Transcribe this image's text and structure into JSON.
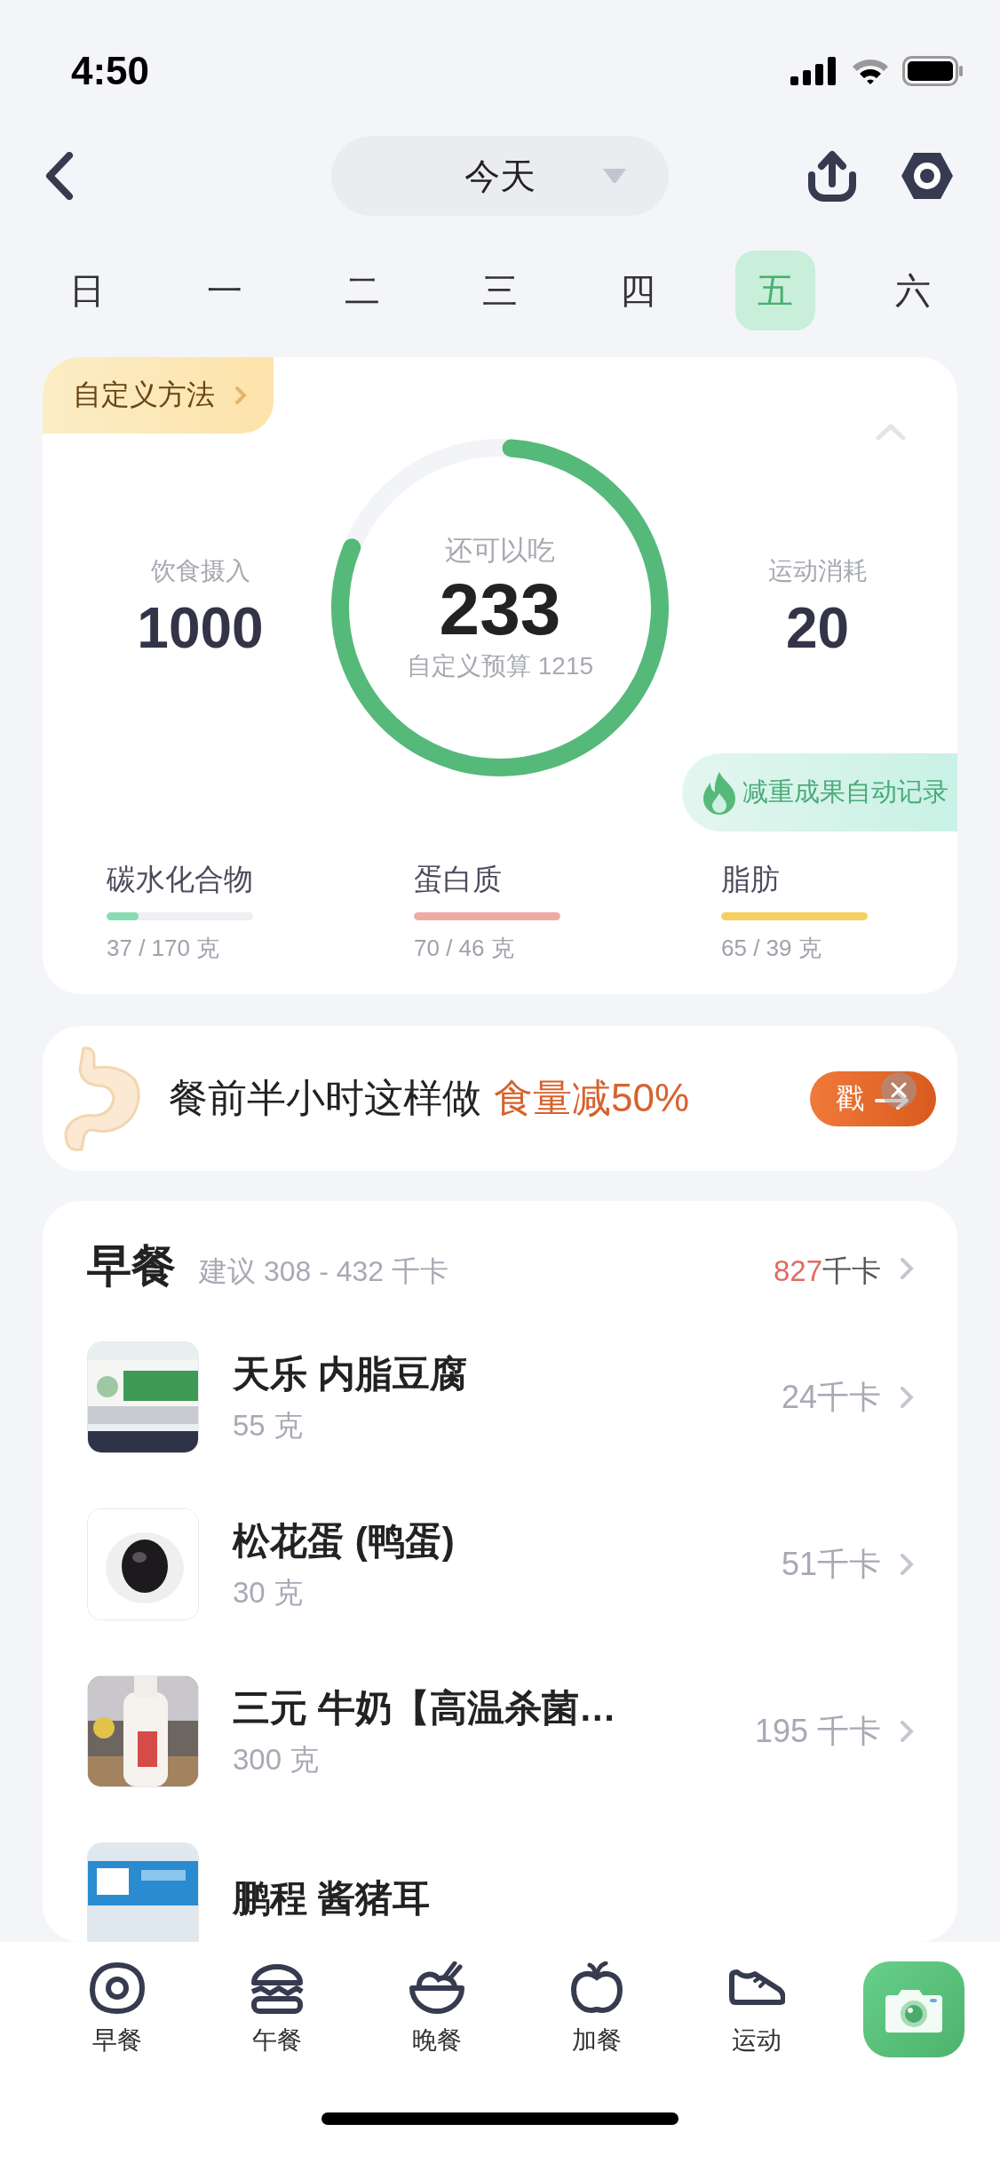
{
  "status_bar": {
    "time": "4:50"
  },
  "header": {
    "date": "今天"
  },
  "week_days": [
    {
      "label": "日",
      "selected": false
    },
    {
      "label": "一",
      "selected": false
    },
    {
      "label": "二",
      "selected": false
    },
    {
      "label": "三",
      "selected": false
    },
    {
      "label": "四",
      "selected": false
    },
    {
      "label": "五",
      "selected": true
    },
    {
      "label": "六",
      "selected": false
    }
  ],
  "summary": {
    "method": "自定义方法",
    "intake": {
      "label": "饮食摄入",
      "value": "1000"
    },
    "remaining": {
      "label": "还可以吃",
      "value": "233",
      "budget": "自定义预算 1215",
      "level": 0.8
    },
    "exercise": {
      "label": "运动消耗",
      "value": "20"
    },
    "auto_record": "减重成果自动记录",
    "macros": [
      {
        "name": "碳水化合物",
        "amount": "37 / 170 克",
        "level": 0.22,
        "color": "#86dcb0"
      },
      {
        "name": "蛋白质",
        "amount": "70 / 46 克",
        "level": 1,
        "color": "#f0aaa6"
      },
      {
        "name": "脂肪",
        "amount": "65 / 39 克",
        "level": 1,
        "color": "#f6cf5c"
      }
    ]
  },
  "banner": {
    "text": "餐前半小时这样做",
    "highlight": "食量减50%",
    "button": "戳"
  },
  "meal": {
    "name": "早餐",
    "suggestion": "建议 308 - 432 千卡",
    "calories": "827",
    "unit": "千卡",
    "foods": [
      {
        "name": "天乐 内脂豆腐",
        "amount": "55 克",
        "calories": "24千卡"
      },
      {
        "name": "松花蛋 (鸭蛋)",
        "amount": "30 克",
        "calories": "51千卡"
      },
      {
        "name": "三元 牛奶【高温杀菌…",
        "amount": "300 克",
        "calories": "195 千卡"
      },
      {
        "name": "鹏程 酱猪耳"
      }
    ]
  },
  "bottom_nav": [
    {
      "label": "早餐"
    },
    {
      "label": "午餐"
    },
    {
      "label": "晚餐"
    },
    {
      "label": "加餐"
    },
    {
      "label": "运动"
    }
  ]
}
